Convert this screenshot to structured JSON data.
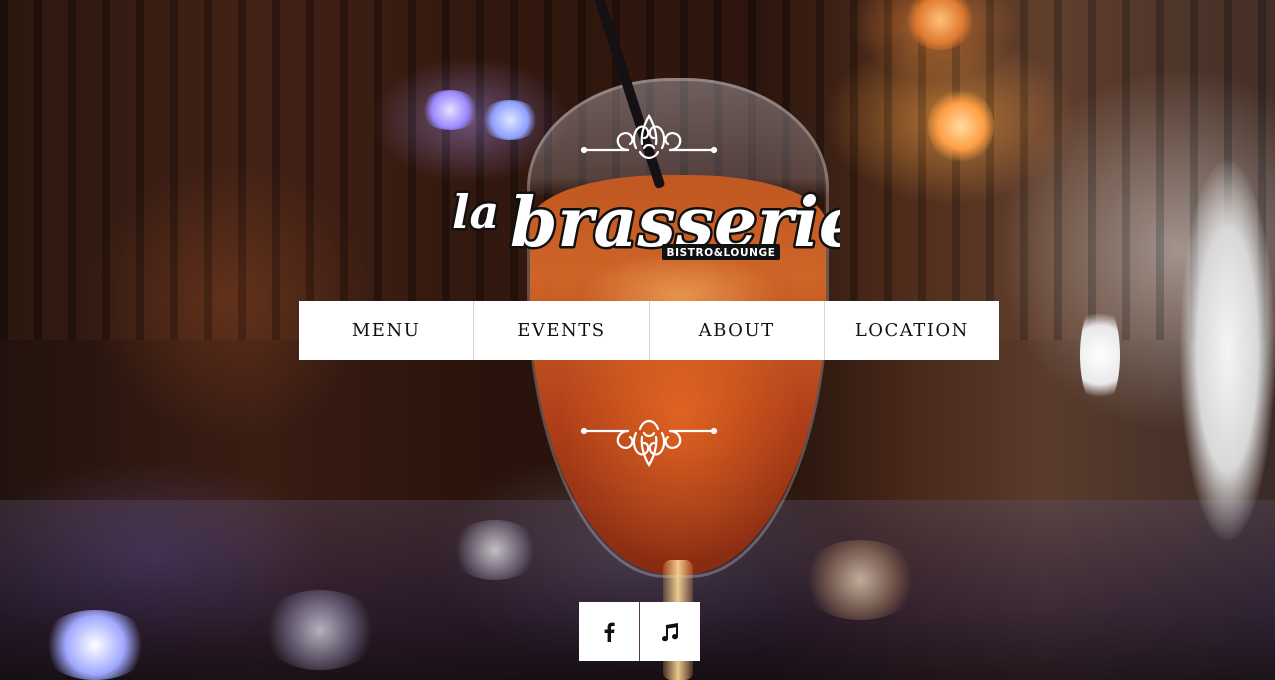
{
  "logo": {
    "script_text": "la",
    "wordmark_text": "brasserie",
    "tagline": "BISTRO&LOUNGE"
  },
  "nav": {
    "items": [
      {
        "label": "MENU"
      },
      {
        "label": "EVENTS"
      },
      {
        "label": "ABOUT"
      },
      {
        "label": "LOCATION"
      }
    ]
  },
  "social": {
    "items": [
      {
        "icon": "facebook-icon"
      },
      {
        "icon": "music-note-icon"
      }
    ]
  },
  "colors": {
    "nav_background": "#ffffff",
    "nav_text": "#111111",
    "logo_fill": "#ffffff",
    "logo_outline": "#111111"
  }
}
